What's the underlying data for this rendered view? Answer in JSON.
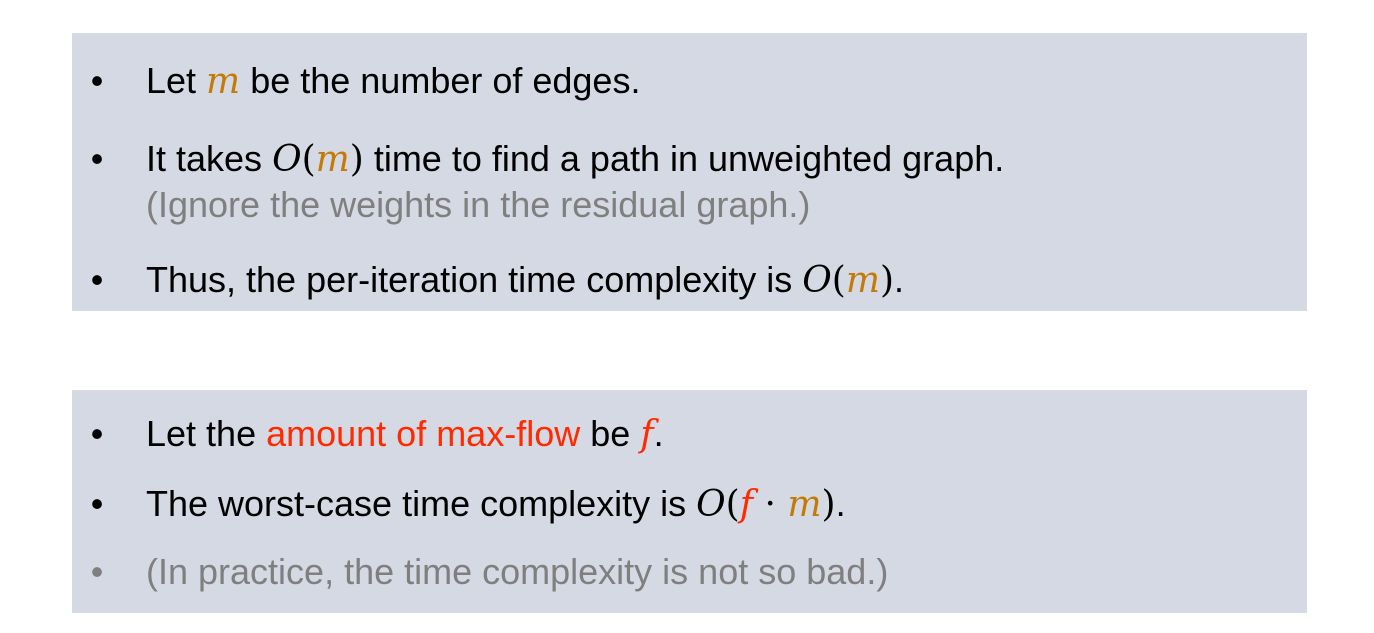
{
  "box1": {
    "item1": {
      "bullet": "•",
      "pre": "Let ",
      "var_m": "m",
      "post": " be the number of edges."
    },
    "item2": {
      "bullet": "•",
      "pre": "It takes ",
      "O": "O",
      "lparen": "(",
      "var_m": "m",
      "rparen": ")",
      "post": " time to find a path in unweighted graph.",
      "note": "(Ignore the weights in the residual graph.)"
    },
    "item3": {
      "bullet": "•",
      "pre": "Thus, the per-iteration time complexity is ",
      "O": "O",
      "lparen": "(",
      "var_m": "m",
      "rparen": ")",
      "post": "."
    }
  },
  "box2": {
    "item1": {
      "bullet": "•",
      "pre": "Let the ",
      "highlight": "amount of max-flow",
      "mid": " be ",
      "var_f": "f",
      "post": "."
    },
    "item2": {
      "bullet": "•",
      "pre": "The worst-case time complexity is ",
      "O": "O",
      "lparen": "(",
      "var_f": "f",
      "dot": " · ",
      "var_m": "m",
      "rparen": ")",
      "post": "."
    },
    "item3": {
      "bullet": "•",
      "text": "(In practice, the time complexity is not so bad.)"
    }
  },
  "colors": {
    "box_bg": "#d5d9e3",
    "var_m": "#c47a06",
    "highlight": "#ff2a00",
    "gray_text": "#7f7f7f"
  }
}
